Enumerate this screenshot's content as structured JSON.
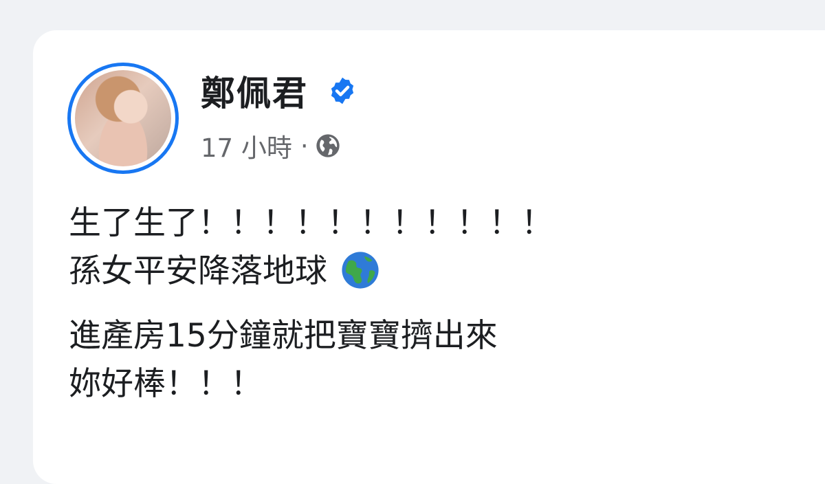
{
  "post": {
    "author": "鄭佩君",
    "timestamp": "17 小時",
    "separator": "·",
    "privacy_icon": "globe-icon",
    "verified_icon": "verified-badge-icon",
    "lines": [
      "生了生了！！！！！！！！！！！",
      "孫女平安降落地球",
      "進產房15分鐘就把寶寶擠出來",
      "妳好棒！！！"
    ],
    "emoji_after_line_2": "earth-globe-emoji"
  },
  "colors": {
    "background": "#f0f2f5",
    "card": "#ffffff",
    "accent": "#1877f2",
    "text": "#1c1e21",
    "secondary_text": "#65676b"
  }
}
